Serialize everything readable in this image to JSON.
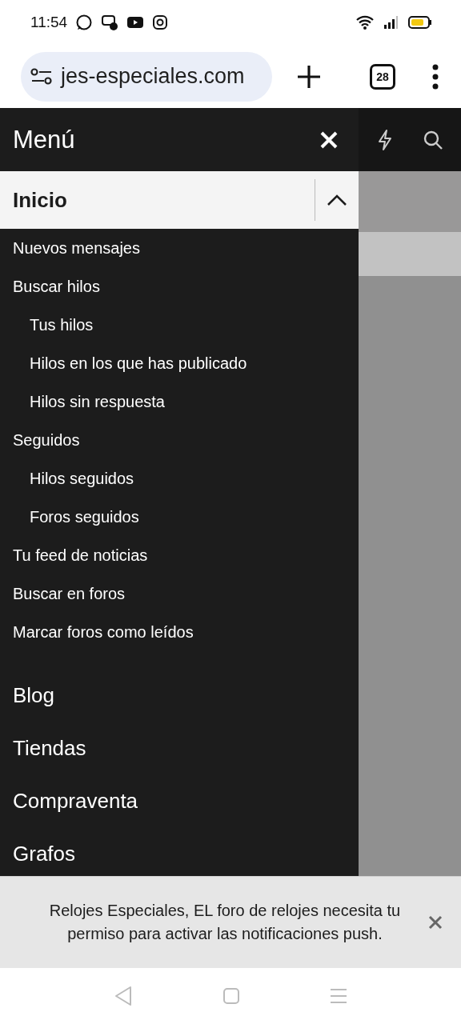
{
  "status_bar": {
    "time": "11:54"
  },
  "browser": {
    "url": "jes-especiales.com",
    "tab_count": "28"
  },
  "menu": {
    "title": "Menú",
    "sections": [
      {
        "label": "Inicio",
        "expanded": true,
        "children": [
          {
            "label": "Nuevos mensajes"
          },
          {
            "label": "Buscar hilos",
            "children": [
              {
                "label": "Tus hilos"
              },
              {
                "label": "Hilos en los que has publicado"
              },
              {
                "label": "Hilos sin respuesta"
              }
            ]
          },
          {
            "label": "Seguidos",
            "children": [
              {
                "label": "Hilos seguidos"
              },
              {
                "label": "Foros seguidos"
              }
            ]
          },
          {
            "label": "Tu feed de noticias"
          },
          {
            "label": "Buscar en foros"
          },
          {
            "label": "Marcar foros como leídos"
          }
        ]
      },
      {
        "label": "Blog",
        "expanded": false
      },
      {
        "label": "Tiendas",
        "expanded": false
      },
      {
        "label": "Compraventa",
        "expanded": false
      },
      {
        "label": "Grafos",
        "expanded": false
      }
    ]
  },
  "notification": {
    "message": "Relojes Especiales, EL foro de relojes necesita tu permiso para activar las notificaciones push."
  }
}
